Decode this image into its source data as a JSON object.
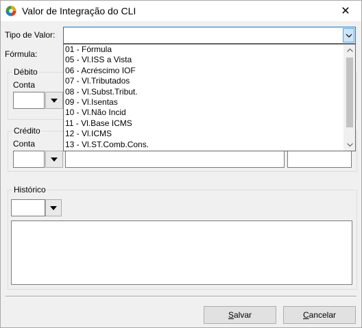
{
  "window": {
    "title": "Valor de Integração do CLI",
    "close_glyph": "✕",
    "icon": "app-globe-icon"
  },
  "form": {
    "tipo_label": "Tipo de Valor:",
    "tipo_value": "",
    "formula_label": "Fórmula:"
  },
  "dropdown": {
    "items": [
      "01 - Fórmula",
      "05 - Vl.ISS a Vista",
      "06 - Acréscimo IOF",
      "07 - Vl.Tributados",
      "08 - Vl.Subst.Tribut.",
      "09 - Vl.Isentas",
      "10 - Vl.Não Incid",
      "11 - Vl.Base ICMS",
      "12 - Vl.ICMS",
      "13 - Vl.ST.Comb.Cons."
    ]
  },
  "debito": {
    "legend": "Débito",
    "conta_label": "Conta"
  },
  "credito": {
    "legend": "Crédito",
    "conta_label": "Conta"
  },
  "historico": {
    "legend": "Histórico"
  },
  "buttons": {
    "salvar_first": "S",
    "salvar_rest": "alvar",
    "cancelar_first": "C",
    "cancelar_rest": "ancelar"
  },
  "colors": {
    "focus_border": "#0078d7",
    "arrow_highlight": "#cce4f7",
    "window_bg": "#f0f0f0"
  }
}
